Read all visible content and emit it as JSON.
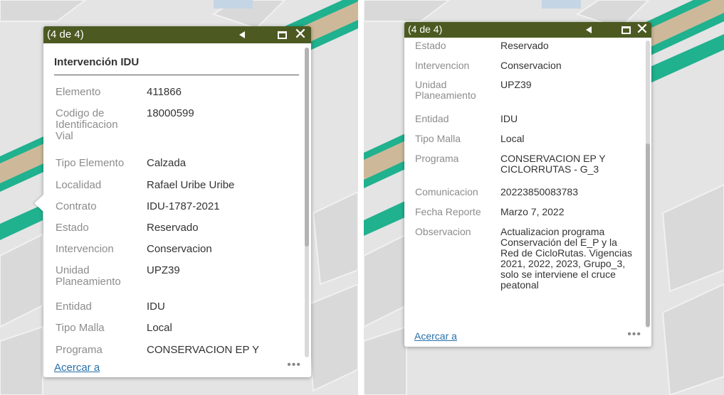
{
  "colors": {
    "titlebar": "#4c5a22",
    "road_teal": "#1fb08e",
    "road_tan": "#cdb99a",
    "link": "#2770a8",
    "label": "#8c8c8c",
    "value": "#333333"
  },
  "left_popup": {
    "counter": "(4 de 4)",
    "header_title": "Intervención IDU",
    "fields": [
      {
        "label": "Elemento",
        "value": "411866"
      },
      {
        "label": "Codigo de Identificacion Vial",
        "value": "18000599"
      },
      {
        "label": "Tipo Elemento",
        "value": "Calzada"
      },
      {
        "label": "Localidad",
        "value": "Rafael Uribe Uribe"
      },
      {
        "label": "Contrato",
        "value": "IDU-1787-2021"
      },
      {
        "label": "Estado",
        "value": "Reservado"
      },
      {
        "label": "Intervencion",
        "value": "Conservacion"
      },
      {
        "label": "Unidad Planeamiento",
        "value": "UPZ39"
      },
      {
        "label": "Entidad",
        "value": "IDU"
      },
      {
        "label": "Tipo Malla",
        "value": "Local"
      },
      {
        "label": "Programa",
        "value": "CONSERVACION EP Y"
      }
    ],
    "footer_link": "Acercar a",
    "more": "•••"
  },
  "right_popup": {
    "counter": "(4 de 4)",
    "fields": [
      {
        "label": "Estado",
        "value": "Reservado"
      },
      {
        "label": "Intervencion",
        "value": "Conservacion"
      },
      {
        "label": "Unidad Planeamiento",
        "value": "UPZ39"
      },
      {
        "label": "Entidad",
        "value": "IDU"
      },
      {
        "label": "Tipo Malla",
        "value": "Local"
      },
      {
        "label": "Programa",
        "value": "CONSERVACION EP Y CICLORRUTAS - G_3"
      },
      {
        "label": "Comunicacion",
        "value": "20223850083783"
      },
      {
        "label": "Fecha Reporte",
        "value": "Marzo 7, 2022"
      },
      {
        "label": "Observacion",
        "value": "Actualizacion programa Conservación del E_P y la Red de CicloRutas. Vigencias 2021, 2022, 2023, Grupo_3, solo se interviene el cruce peatonal"
      }
    ],
    "footer_link": "Acercar a",
    "more": "•••"
  }
}
